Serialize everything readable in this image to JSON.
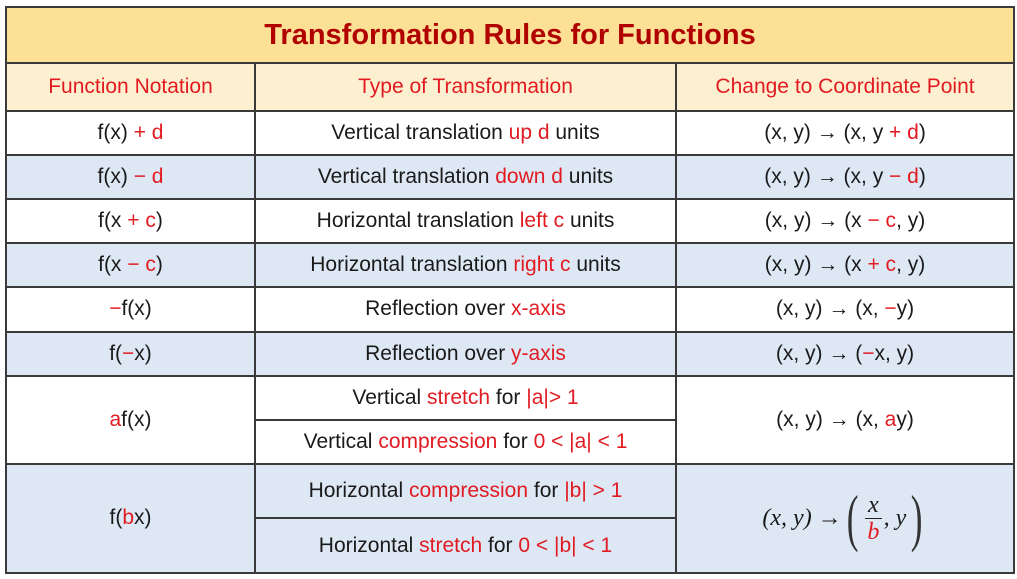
{
  "title": "Transformation Rules for Functions",
  "headers": {
    "notation": "Function Notation",
    "type": "Type of Transformation",
    "change": "Change to Coordinate Point"
  },
  "colors": {
    "title_bg": "#fbe096",
    "header_bg": "#fdf0d0",
    "stripe_bg": "#dde8f4",
    "accent_red": "#e11b22",
    "title_red": "#b00000"
  },
  "rows": [
    {
      "notation": {
        "pre": "f(x) ",
        "red": "+ d",
        "post": ""
      },
      "type": {
        "pre": "Vertical translation ",
        "red": "up d",
        "post": " units"
      },
      "change": {
        "pre": "(x, y) → (x, y ",
        "red": "+ d",
        "post": ")"
      }
    },
    {
      "notation": {
        "pre": "f(x) ",
        "red": "− d",
        "post": ""
      },
      "type": {
        "pre": "Vertical translation ",
        "red": "down d",
        "post": " units"
      },
      "change": {
        "pre": "(x, y) → (x, y ",
        "red": "− d",
        "post": ")"
      }
    },
    {
      "notation": {
        "pre": "f(x ",
        "red": "+ c",
        "post": ")"
      },
      "type": {
        "pre": "Horizontal translation ",
        "red": "left c",
        "post": " units"
      },
      "change": {
        "pre": "(x, y) → (x ",
        "red": "− c",
        "post": ", y)"
      }
    },
    {
      "notation": {
        "pre": "f(x ",
        "red": "− c",
        "post": ")"
      },
      "type": {
        "pre": "Horizontal translation ",
        "red": "right c",
        "post": " units"
      },
      "change": {
        "pre": "(x, y) → (x ",
        "red": "+ c",
        "post": ", y)"
      }
    },
    {
      "notation": {
        "pre": "",
        "red": "−",
        "post": "f(x)"
      },
      "type": {
        "pre": "Reflection over ",
        "red": "x-axis",
        "post": ""
      },
      "change": {
        "pre": "(x, y) → (x, ",
        "red": "−",
        "post": "y)"
      }
    },
    {
      "notation": {
        "pre": "f(",
        "red": "−",
        "post": "x)"
      },
      "type": {
        "pre": "Reflection over ",
        "red": "y-axis",
        "post": ""
      },
      "change": {
        "pre": "(x, y) → (",
        "red": "−",
        "post": "x, y)"
      }
    }
  ],
  "vertical_scale": {
    "notation": {
      "red": "a",
      "post": "f(x)"
    },
    "stretch": {
      "pre": "Vertical ",
      "red": "stretch",
      "mid": " for ",
      "cond": "|a|> 1"
    },
    "compression": {
      "pre": "Vertical ",
      "red": "compression",
      "mid": " for ",
      "cond": "0 < |a| < 1"
    },
    "change": {
      "pre": "(x, y) → (x, ",
      "red": "a",
      "post": "y)"
    }
  },
  "horizontal_scale": {
    "notation": {
      "pre": "f(",
      "red": "b",
      "post": "x)"
    },
    "compression": {
      "pre": "Horizontal ",
      "red": "compression",
      "mid": " for ",
      "cond": "|b| > 1"
    },
    "stretch": {
      "pre": "Horizontal ",
      "red": "stretch",
      "mid": " for ",
      "cond": "0 < |b| < 1"
    },
    "change": {
      "lhs": "(x, y) →",
      "num": "x",
      "den": "b",
      "tail": ", y"
    }
  }
}
